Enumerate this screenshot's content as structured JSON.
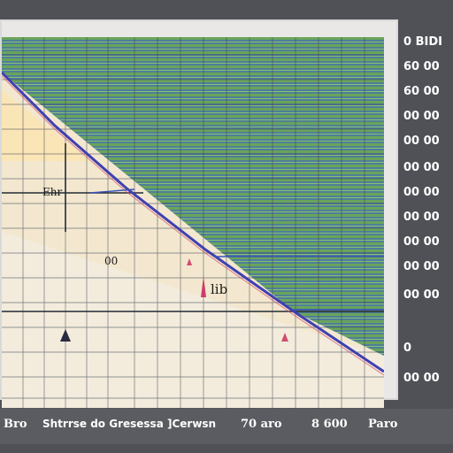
{
  "right_axis": {
    "top_label": "0 BIDI",
    "ticks": [
      "60 00",
      "60 00",
      "00 00",
      "00 00",
      "00 00",
      "00 00",
      "00 00",
      "00 00",
      "00 00",
      "00 00",
      "0",
      "00 00"
    ]
  },
  "plot": {
    "marker_label_1": "Ehr",
    "marker_label_2": "00",
    "marker_label_3": "lib"
  },
  "bottom_bar": {
    "left_label": "Bro",
    "center_label": "Shtrrse do Gresessa ]Cerwsn",
    "mid_label": "70 aro",
    "value_label": "8 600",
    "right_label": "Paro"
  },
  "colors": {
    "frame": "#505157",
    "plot_bg": "#f6edd8",
    "upper_region": "#4f8a82",
    "diagonal": "#4a4aa8",
    "grid": "#3f4650"
  }
}
